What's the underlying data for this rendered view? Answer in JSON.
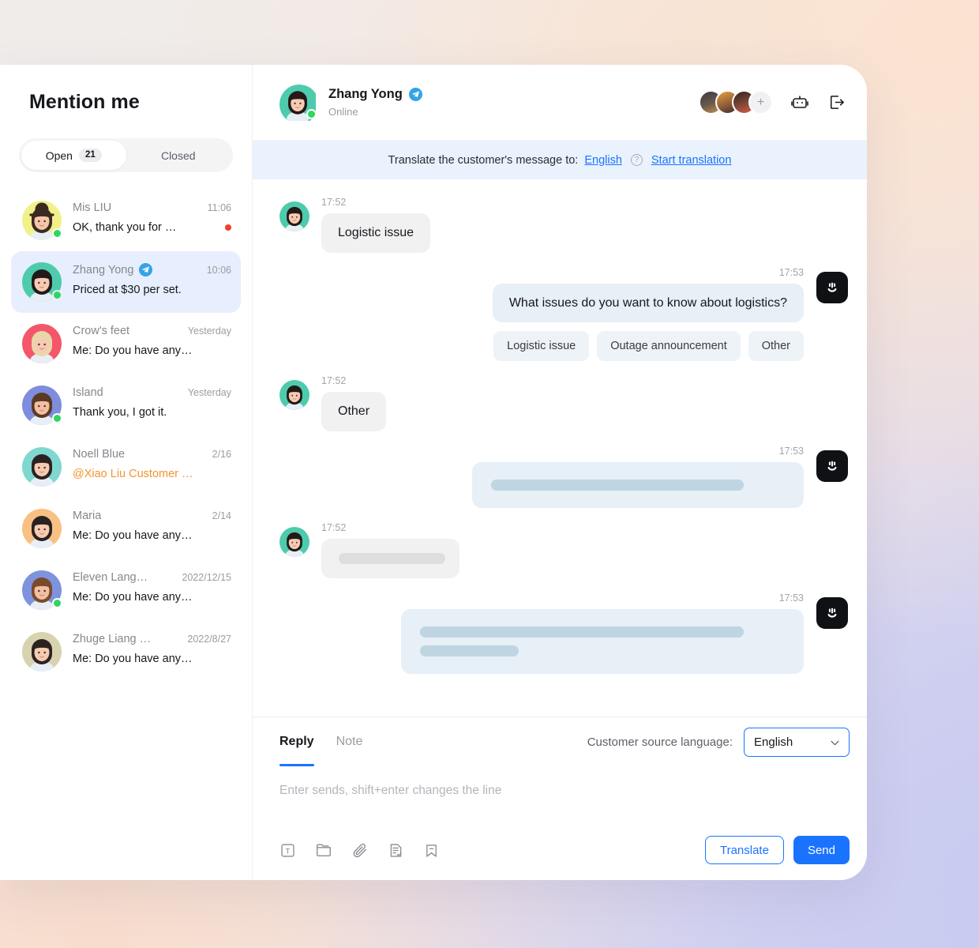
{
  "theme": {
    "accent": "#1a73ff",
    "selected_row_bg": "#e7eefd",
    "translate_bar_bg": "#eaf2fd",
    "mention_color": "#f5932e",
    "online_dot": "#2fd65f",
    "unread_dot": "#f23f2c"
  },
  "sidebar": {
    "title": "Mention me",
    "tabs": [
      {
        "label": "Open",
        "badge": "21",
        "active": true
      },
      {
        "label": "Closed",
        "badge": "",
        "active": false
      }
    ],
    "conversations": [
      {
        "name": "Mis LIU",
        "time": "11:06",
        "preview": "OK, thank you for …",
        "online": true,
        "telegram": false,
        "selected": false,
        "unread": true,
        "mention": false,
        "avatar": "avatar-mis-liu"
      },
      {
        "name": "Zhang Yong",
        "time": "10:06",
        "preview": "Priced at $30 per set.",
        "online": true,
        "telegram": true,
        "selected": true,
        "unread": false,
        "mention": false,
        "avatar": "avatar-zhang-yong"
      },
      {
        "name": "Crow's feet",
        "time": "Yesterday",
        "preview": "Me: Do you have any…",
        "online": false,
        "telegram": false,
        "selected": false,
        "unread": false,
        "mention": false,
        "avatar": "avatar-crows-feet"
      },
      {
        "name": "Island",
        "time": "Yesterday",
        "preview": "Thank you, I got it.",
        "online": true,
        "telegram": false,
        "selected": false,
        "unread": false,
        "mention": false,
        "avatar": "avatar-island"
      },
      {
        "name": "Noell Blue",
        "time": "2/16",
        "preview": "@Xiao Liu Customer …",
        "online": false,
        "telegram": false,
        "selected": false,
        "unread": false,
        "mention": true,
        "avatar": "avatar-noell-blue"
      },
      {
        "name": "Maria",
        "time": "2/14",
        "preview": "Me: Do you have any…",
        "online": false,
        "telegram": false,
        "selected": false,
        "unread": false,
        "mention": false,
        "avatar": "avatar-maria"
      },
      {
        "name": "Eleven Lang…",
        "time": "2022/12/15",
        "preview": "Me: Do you have any…",
        "online": true,
        "telegram": false,
        "selected": false,
        "unread": false,
        "mention": false,
        "avatar": "avatar-eleven-lang"
      },
      {
        "name": "Zhuge Liang …",
        "time": "2022/8/27",
        "preview": "Me: Do you have any…",
        "online": false,
        "telegram": false,
        "selected": false,
        "unread": false,
        "mention": false,
        "avatar": "avatar-zhuge-liang"
      }
    ]
  },
  "chat": {
    "header": {
      "name": "Zhang Yong",
      "status": "Online",
      "channel_icon": "telegram-icon",
      "participants_more": "+",
      "bot_icon": "bot-icon",
      "leave_icon": "logout-icon"
    },
    "translate_bar": {
      "prefix": "Translate the customer's message to:",
      "language": "English",
      "help_icon": "question-mark-icon",
      "action": "Start translation"
    },
    "messages": [
      {
        "side": "in",
        "time": "17:52",
        "text": "Logistic issue",
        "skeleton": []
      },
      {
        "side": "out",
        "time": "17:53",
        "text": "What issues do you want to know about logistics?",
        "skeleton": [],
        "chips": [
          "Logistic issue",
          "Outage announcement",
          "Other"
        ]
      },
      {
        "side": "in",
        "time": "17:52",
        "text": "Other",
        "skeleton": []
      },
      {
        "side": "out",
        "time": "17:53",
        "text": "",
        "skeleton": [
          320
        ]
      },
      {
        "side": "in",
        "time": "17:52",
        "text": "",
        "skeleton": [
          135
        ]
      },
      {
        "side": "out",
        "time": "17:53",
        "text": "",
        "skeleton": [
          410,
          125
        ]
      }
    ]
  },
  "composer": {
    "tabs": [
      {
        "label": "Reply",
        "active": true
      },
      {
        "label": "Note",
        "active": false
      }
    ],
    "language_label": "Customer source language:",
    "language_value": "English",
    "chevron_icon": "chevron-down-icon",
    "placeholder": "Enter sends, shift+enter changes the line",
    "tools": [
      {
        "icon": "text-format-icon"
      },
      {
        "icon": "folder-icon"
      },
      {
        "icon": "paperclip-icon"
      },
      {
        "icon": "quick-reply-icon"
      },
      {
        "icon": "bookmark-icon"
      }
    ],
    "translate_button": "Translate",
    "send_button": "Send"
  }
}
